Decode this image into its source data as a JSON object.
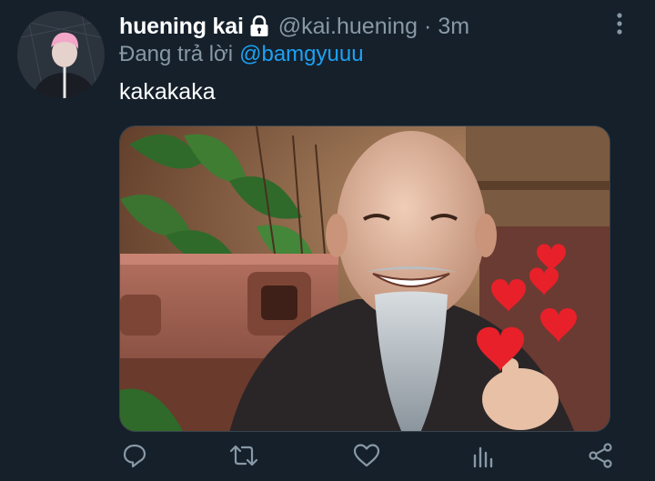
{
  "tweet": {
    "display_name": "huening kai",
    "handle": "@kai.huening",
    "separator": "·",
    "time": "3m",
    "reply_prefix": "Đang trả lời",
    "reply_mention": "@bamgyuuu",
    "text": "kakakaka"
  },
  "icons": {
    "protected": "lock-icon",
    "more": "more-vertical-icon",
    "reply": "reply-icon",
    "retweet": "retweet-icon",
    "like": "heart-icon",
    "analytics": "analytics-icon",
    "share": "share-icon"
  },
  "colors": {
    "background": "#15202b",
    "text_primary": "#ffffff",
    "text_secondary": "#8899a6",
    "link": "#1da1f2",
    "heart_emoji": "#e8202a"
  }
}
